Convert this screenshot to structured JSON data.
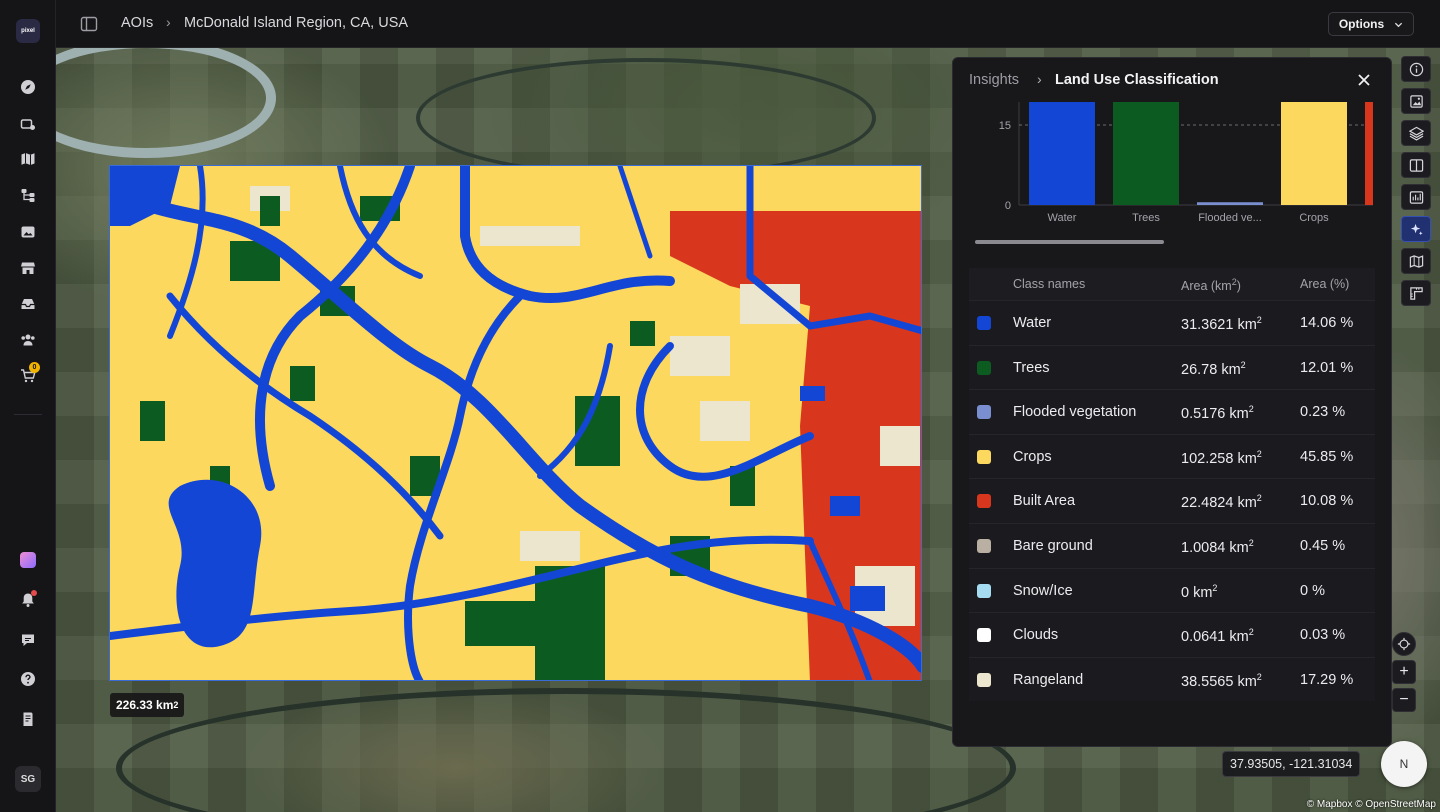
{
  "app": {
    "logo_text": "pixel",
    "user_initials": "SG",
    "cart_count": "0"
  },
  "rail": {
    "icons": [
      "compass-icon",
      "satellite-icon",
      "map-icon",
      "workflow-icon",
      "gallery-icon",
      "store-icon",
      "storage-icon",
      "team-icon",
      "cart-icon",
      "app-tile-icon",
      "bell-icon",
      "chat-icon",
      "help-icon",
      "docs-icon"
    ]
  },
  "header": {
    "breadcrumb_root": "AOIs",
    "breadcrumb_current": "McDonald Island Region, CA, USA",
    "options_label": "Options"
  },
  "map": {
    "area_value": "226.33 km",
    "area_unit_sup": "2",
    "coordinates": "37.93505, -121.31034",
    "compass_label": "N",
    "attribution": "© Mapbox © OpenStreetMap"
  },
  "panel": {
    "breadcrumb_parent": "Insights",
    "title": "Land Use Classification",
    "table_headers": {
      "class": "Class names",
      "area_km": "Area (km",
      "area_km_sup": "2",
      "area_km_tail": ")",
      "area_pct": "Area (%)"
    },
    "rows": [
      {
        "name": "Water",
        "area": "31.3621 km",
        "pct": "14.06 %",
        "color": "#1446d6"
      },
      {
        "name": "Trees",
        "area": "26.78 km",
        "pct": "12.01 %",
        "color": "#0c5c22"
      },
      {
        "name": "Flooded vegetation",
        "area": "0.5176 km",
        "pct": "0.23 %",
        "color": "#7a8fd0"
      },
      {
        "name": "Crops",
        "area": "102.258 km",
        "pct": "45.85 %",
        "color": "#fcd85e"
      },
      {
        "name": "Built Area",
        "area": "22.4824 km",
        "pct": "10.08 %",
        "color": "#d8371e"
      },
      {
        "name": "Bare ground",
        "area": "1.0084 km",
        "pct": "0.45 %",
        "color": "#b9afa2"
      },
      {
        "name": "Snow/Ice",
        "area": "0 km",
        "pct": "0 %",
        "color": "#a6dcf2"
      },
      {
        "name": "Clouds",
        "area": "0.0641 km",
        "pct": "0.03 %",
        "color": "#ffffff"
      },
      {
        "name": "Rangeland",
        "area": "38.5565 km",
        "pct": "17.29 %",
        "color": "#ece6cf"
      }
    ]
  },
  "chart_data": {
    "type": "bar",
    "categories": [
      "Water",
      "Trees",
      "Flooded ve...",
      "Crops"
    ],
    "values": [
      31.3621,
      26.78,
      0.5176,
      102.258
    ],
    "colors": [
      "#1446d6",
      "#0c5c22",
      "#7a8fd0",
      "#fcd85e"
    ],
    "partial_next_bar": {
      "color": "#d8371e",
      "value": 22.4824
    },
    "y_ticks": [
      0,
      15
    ],
    "ylim": [
      0,
      45
    ],
    "dashed_gridline_at": 15,
    "xlabel": "",
    "ylabel": ""
  }
}
